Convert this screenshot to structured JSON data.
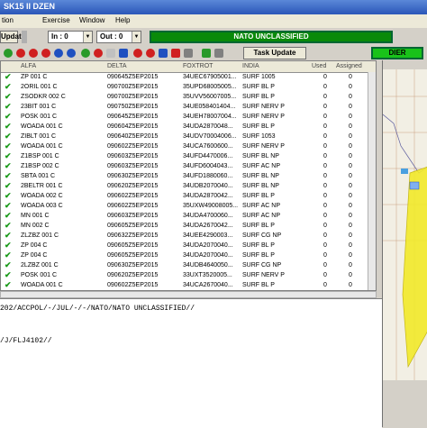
{
  "window": {
    "title": "SK15 II DZEN"
  },
  "menu": [
    "tion",
    "Exercise",
    "Window",
    "Help"
  ],
  "toolbar": {
    "update_label": "Update",
    "in_value": "In : 0",
    "out_value": "Out : 0",
    "classification_banner": "NATO UNCLASSIFIED",
    "task_update_label": "Task Update",
    "dier_label": "DIER"
  },
  "table": {
    "columns": [
      "ALFA",
      "DELTA",
      "FOXTROT",
      "INDIA",
      "Used",
      "Assigned"
    ],
    "rows": [
      [
        "ZP 001 C",
        "090645Z5EP2015",
        "34UEC67905001...",
        "SURF 1005",
        "0",
        "0"
      ],
      [
        "2ORIL 001 C",
        "090700Z5EP2015",
        "35UPD68005005...",
        "SURF BL P",
        "0",
        "0"
      ],
      [
        "ZSODKR 002 C",
        "090700Z5EP2015",
        "35UVV56007005...",
        "SURF BL P",
        "0",
        "0"
      ],
      [
        "23BIT 001 C",
        "090750Z5EP2015",
        "34UE058401404...",
        "SURF NERV P",
        "0",
        "0"
      ],
      [
        "POSK 001 C",
        "090645Z5EP2015",
        "34UEH78007004...",
        "SURF NERV P",
        "0",
        "0"
      ],
      [
        "WOADA 001 C",
        "090604Z5EP2015",
        "34UDA2870048...",
        "SURF BL P",
        "0",
        "0"
      ],
      [
        "ZIBLT 001 C",
        "090640Z5EP2015",
        "34UDV70004006...",
        "SURF 1053",
        "0",
        "0"
      ],
      [
        "WOADA 001 C",
        "090602Z5EP2015",
        "34UCA7600600...",
        "SURF NERV P",
        "0",
        "0"
      ],
      [
        "Z1BSP 001 C",
        "090603Z5EP2015",
        "34UFD4470006...",
        "SURF BL NP",
        "0",
        "0"
      ],
      [
        "Z1BSP 002 C",
        "090603Z5EP2015",
        "34UFD6004043...",
        "SURF AC NP",
        "0",
        "0"
      ],
      [
        "SBTA 001 C",
        "090630Z5EP2015",
        "34UFD1880060...",
        "SURF BL NP",
        "0",
        "0"
      ],
      [
        "2BELTR 001 C",
        "090620Z5EP2015",
        "34UDB2070040...",
        "SURF BL NP",
        "0",
        "0"
      ],
      [
        "WOADA 002 C",
        "090602Z5EP2015",
        "34UDA2870042...",
        "SURF BL P",
        "0",
        "0"
      ],
      [
        "WOADA 003 C",
        "090602Z5EP2015",
        "35UXW49008005...",
        "SURF AC NP",
        "0",
        "0"
      ],
      [
        "MN 001 C",
        "090603Z5EP2015",
        "34UDA4700060...",
        "SURF AC NP",
        "0",
        "0"
      ],
      [
        "MN 002 C",
        "090605Z5EP2015",
        "34UDA2670042...",
        "SURF BL P",
        "0",
        "0"
      ],
      [
        "ZLZBZ 001 C",
        "090632Z5EP2015",
        "34UEE4290003...",
        "SURF CG NP",
        "0",
        "0"
      ],
      [
        "ZP 004 C",
        "090605Z5EP2015",
        "34UDA2070040...",
        "SURF BL P",
        "0",
        "0"
      ],
      [
        "ZP 004 C",
        "090605Z5EP2015",
        "34UDA2070040...",
        "SURF BL P",
        "0",
        "0"
      ],
      [
        "2LZBZ 001 C",
        "090630Z5EP2015",
        "34UDB4640050...",
        "SURF CG NP",
        "0",
        "0"
      ],
      [
        "POSK 001 C",
        "090620Z5EP2015",
        "33UXT3520005...",
        "SURF NERV P",
        "0",
        "0"
      ],
      [
        "WOADA 001 C",
        "090602Z5EP2015",
        "34UCA2670040...",
        "SURF BL P",
        "0",
        "0"
      ]
    ]
  },
  "message": {
    "line1": "202/ACCPOL/-/JUL/-/-/NATO/NATO UNCLASSIFIED//",
    "line2": "/J/FLJ4102//"
  },
  "colors": {
    "banner_green": "#0a8a0a",
    "map_yellow": "#f2ea2a",
    "check_green": "#1a9a1a"
  }
}
